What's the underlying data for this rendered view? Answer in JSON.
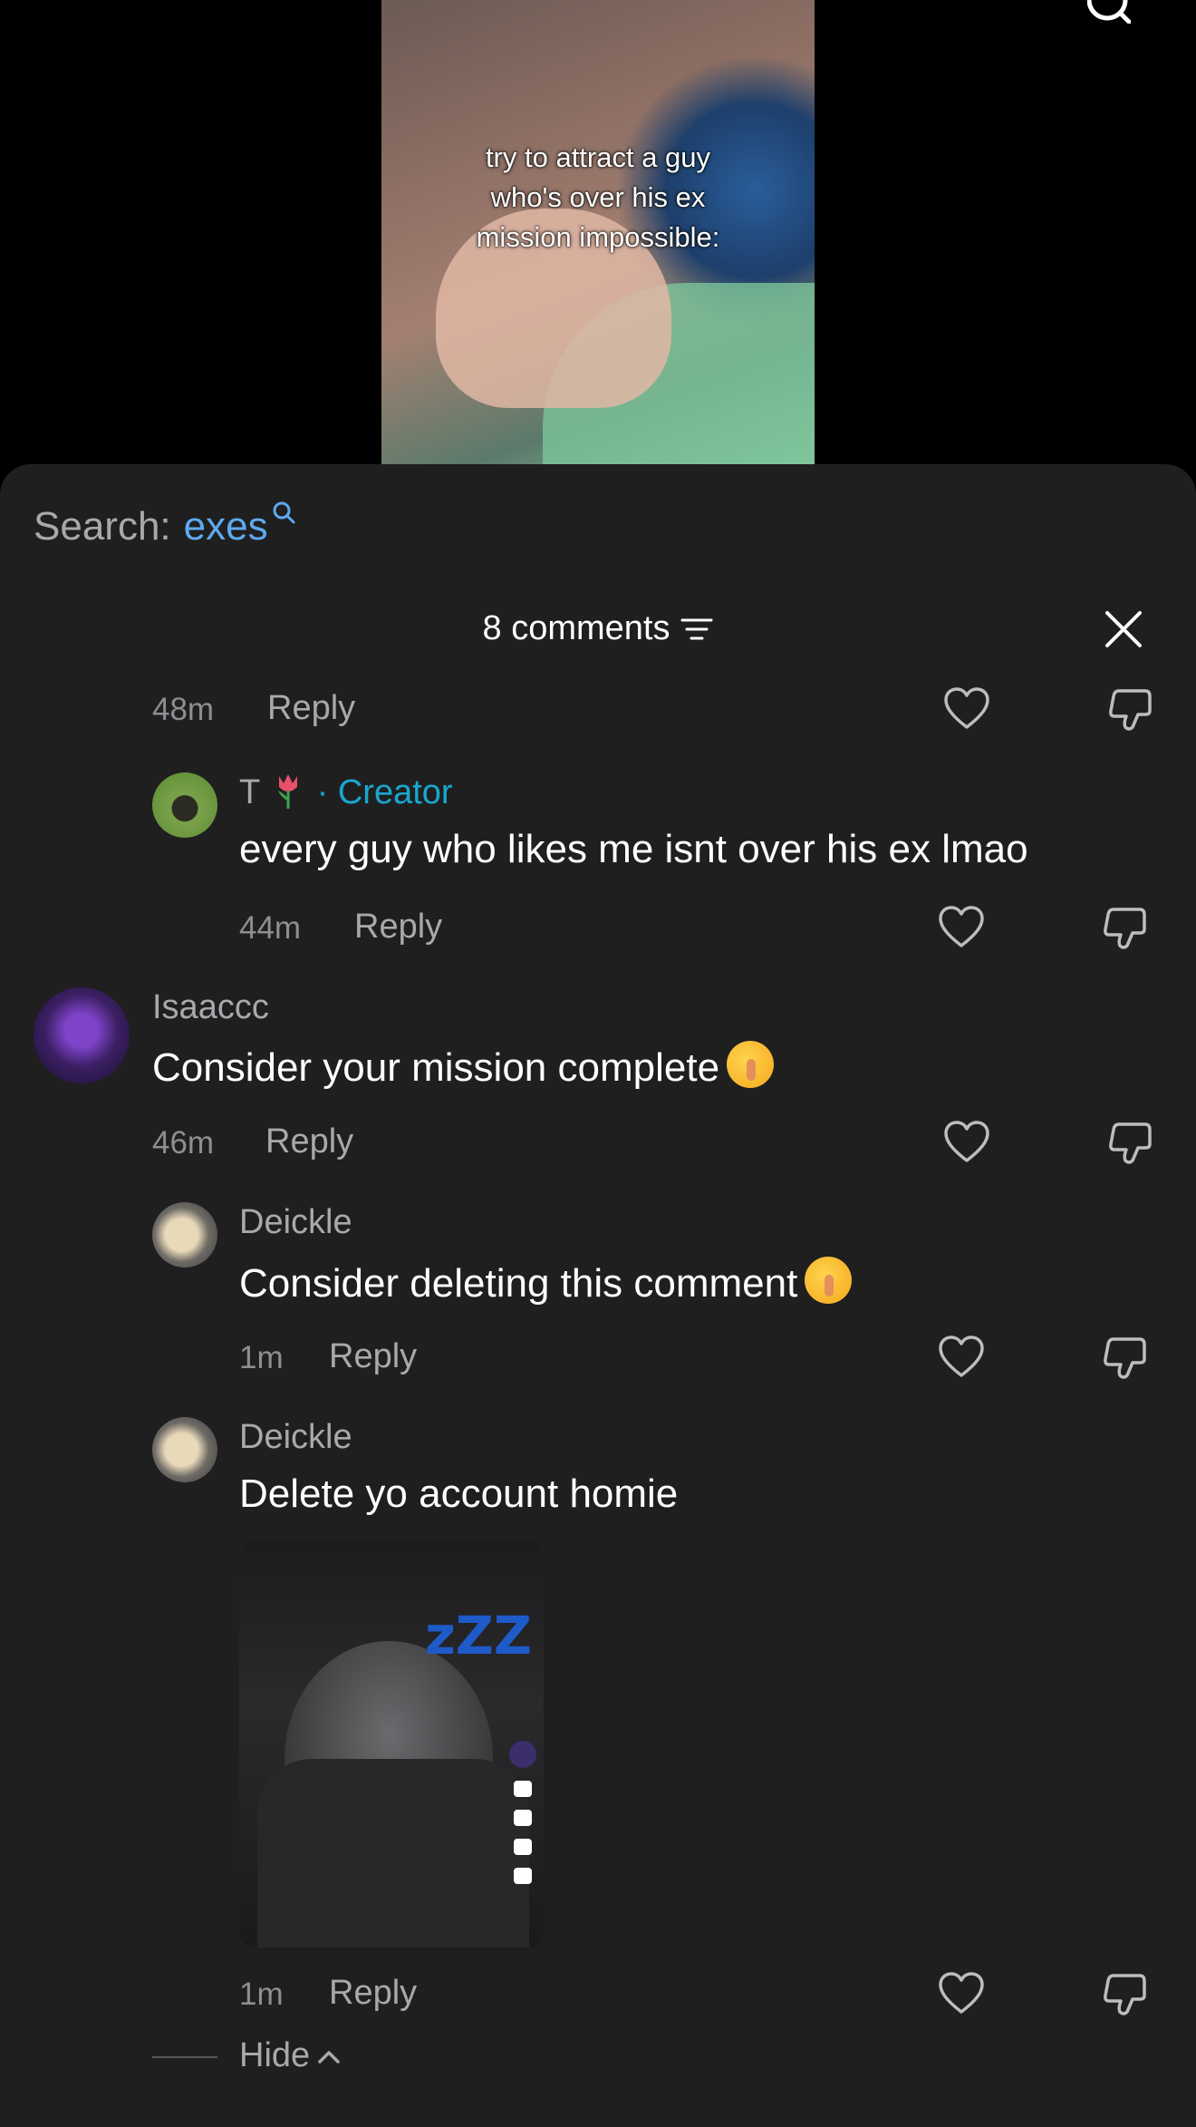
{
  "video": {
    "caption_lines": [
      "try to attract a guy",
      "who's over his ex",
      "mission impossible:"
    ]
  },
  "search": {
    "label": "Search:",
    "term": "exes"
  },
  "header": {
    "count_label": "8 comments"
  },
  "comments": [
    {
      "time": "48m",
      "reply": "Reply"
    },
    {
      "user": "T",
      "badge": "· Creator",
      "text": "every guy who likes me isnt over his ex lmao",
      "time": "44m",
      "reply": "Reply"
    },
    {
      "user": "Isaaccc",
      "text": "Consider your mission complete",
      "time": "46m",
      "reply": "Reply"
    },
    {
      "user": "Deickle",
      "text": "Consider deleting this comment",
      "time": "1m",
      "reply": "Reply"
    },
    {
      "user": "Deickle",
      "text": "Delete yo account homie",
      "time": "1m",
      "reply": "Reply",
      "sticker_text": "zZZ"
    }
  ],
  "footer": {
    "hide_label": "Hide"
  },
  "colors": {
    "sheet_bg": "#1f1f20",
    "creator": "#19a7cf",
    "search_term": "#5ea9ef"
  }
}
